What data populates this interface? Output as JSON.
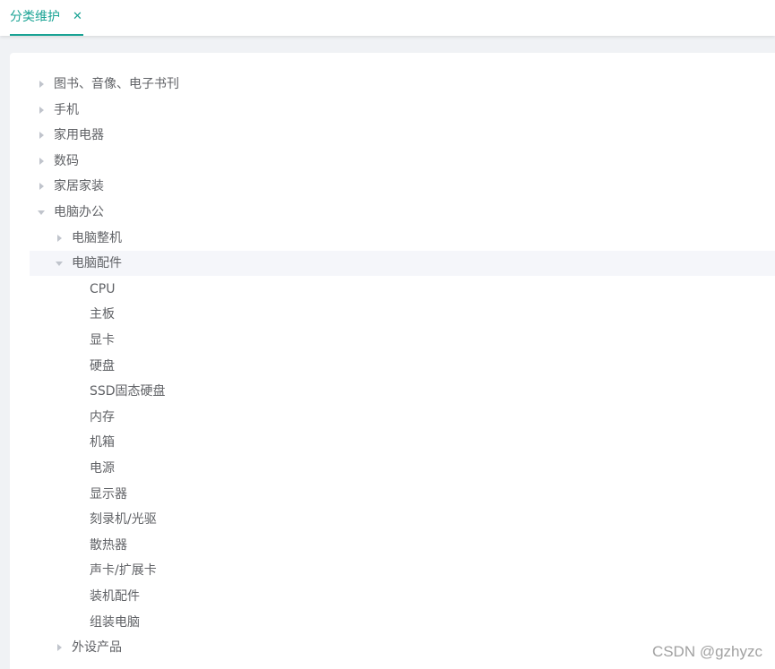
{
  "tabs": [
    {
      "label": "分类维护",
      "close_icon": "close-icon",
      "active": true
    }
  ],
  "accent_color": "#1aa394",
  "tree": [
    {
      "label": "图书、音像、电子书刊",
      "level": 0,
      "expanded": false,
      "leaf": false
    },
    {
      "label": "手机",
      "level": 0,
      "expanded": false,
      "leaf": false
    },
    {
      "label": "家用电器",
      "level": 0,
      "expanded": false,
      "leaf": false
    },
    {
      "label": "数码",
      "level": 0,
      "expanded": false,
      "leaf": false
    },
    {
      "label": "家居家装",
      "level": 0,
      "expanded": false,
      "leaf": false
    },
    {
      "label": "电脑办公",
      "level": 0,
      "expanded": true,
      "leaf": false
    },
    {
      "label": "电脑整机",
      "level": 1,
      "expanded": false,
      "leaf": false
    },
    {
      "label": "电脑配件",
      "level": 1,
      "expanded": true,
      "leaf": false,
      "highlight": true
    },
    {
      "label": "CPU",
      "level": 2,
      "leaf": true
    },
    {
      "label": "主板",
      "level": 2,
      "leaf": true
    },
    {
      "label": "显卡",
      "level": 2,
      "leaf": true
    },
    {
      "label": "硬盘",
      "level": 2,
      "leaf": true
    },
    {
      "label": "SSD固态硬盘",
      "level": 2,
      "leaf": true
    },
    {
      "label": "内存",
      "level": 2,
      "leaf": true
    },
    {
      "label": "机箱",
      "level": 2,
      "leaf": true
    },
    {
      "label": "电源",
      "level": 2,
      "leaf": true
    },
    {
      "label": "显示器",
      "level": 2,
      "leaf": true
    },
    {
      "label": "刻录机/光驱",
      "level": 2,
      "leaf": true
    },
    {
      "label": "散热器",
      "level": 2,
      "leaf": true
    },
    {
      "label": "声卡/扩展卡",
      "level": 2,
      "leaf": true
    },
    {
      "label": "装机配件",
      "level": 2,
      "leaf": true
    },
    {
      "label": "组装电脑",
      "level": 2,
      "leaf": true
    },
    {
      "label": "外设产品",
      "level": 1,
      "expanded": false,
      "leaf": false
    }
  ],
  "watermark": "CSDN @gzhyzc"
}
